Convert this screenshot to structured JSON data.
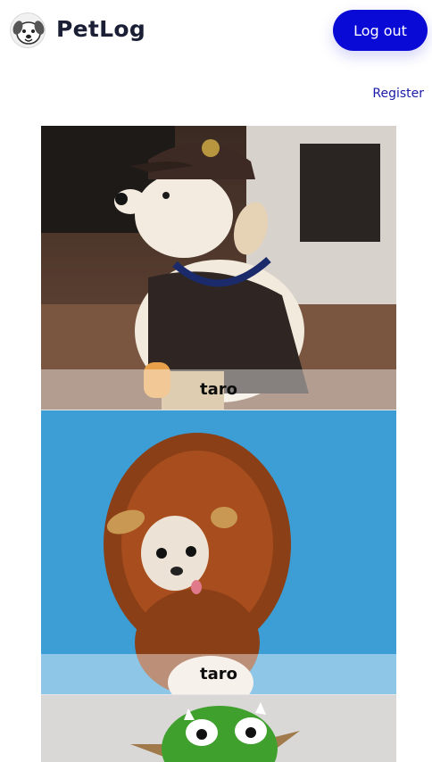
{
  "header": {
    "brand": "PetLog",
    "logo_icon": "dog-face-icon",
    "logout_label": "Log out"
  },
  "nav": {
    "register_label": "Register"
  },
  "feed": {
    "posts": [
      {
        "caption": "taro",
        "image": "dog-in-ups-costume"
      },
      {
        "caption": "taro",
        "image": "chihuahua-in-lion-mane"
      },
      {
        "caption": "",
        "image": "dog-in-green-dragon-costume"
      }
    ]
  },
  "colors": {
    "accent": "#0a0ad6",
    "brand_text": "#1a1f36",
    "link": "#1a1aa8"
  }
}
